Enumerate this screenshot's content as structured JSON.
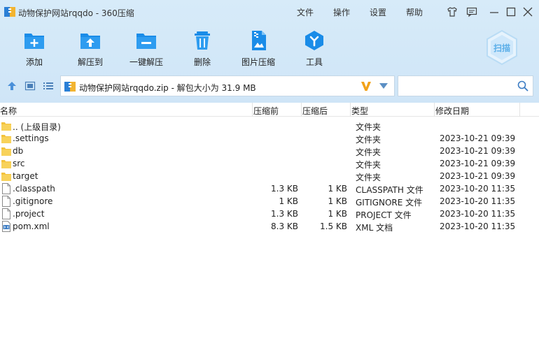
{
  "window": {
    "title": "动物保护网站rqqdo - 360压缩",
    "menu": [
      "文件",
      "操作",
      "设置",
      "帮助"
    ]
  },
  "toolbar": {
    "items": [
      {
        "label": "添加",
        "icon": "add-icon"
      },
      {
        "label": "解压到",
        "icon": "extract-to-icon"
      },
      {
        "label": "一键解压",
        "icon": "one-click-extract-icon"
      },
      {
        "label": "删除",
        "icon": "delete-icon"
      },
      {
        "label": "图片压缩",
        "icon": "image-compress-icon"
      },
      {
        "label": "工具",
        "icon": "tools-icon"
      }
    ],
    "scan_label": "扫描"
  },
  "address": {
    "path": "动物保护网站rqqdo.zip - 解包大小为 31.9 MB"
  },
  "search": {
    "placeholder": "",
    "value": ""
  },
  "list": {
    "columns": [
      "名称",
      "压缩前",
      "压缩后",
      "类型",
      "修改日期"
    ],
    "rows": [
      {
        "name": ".. (上级目录)",
        "size": "",
        "csize": "",
        "type": "文件夹",
        "date": "",
        "kind": "folder"
      },
      {
        "name": ".settings",
        "size": "",
        "csize": "",
        "type": "文件夹",
        "date": "2023-10-21 09:39",
        "kind": "folder"
      },
      {
        "name": "db",
        "size": "",
        "csize": "",
        "type": "文件夹",
        "date": "2023-10-21 09:39",
        "kind": "folder"
      },
      {
        "name": "src",
        "size": "",
        "csize": "",
        "type": "文件夹",
        "date": "2023-10-21 09:39",
        "kind": "folder"
      },
      {
        "name": "target",
        "size": "",
        "csize": "",
        "type": "文件夹",
        "date": "2023-10-21 09:39",
        "kind": "folder"
      },
      {
        "name": ".classpath",
        "size": "1.3 KB",
        "csize": "1 KB",
        "type": "CLASSPATH 文件",
        "date": "2023-10-20 11:35",
        "kind": "file"
      },
      {
        "name": ".gitignore",
        "size": "1 KB",
        "csize": "1 KB",
        "type": "GITIGNORE 文件",
        "date": "2023-10-20 11:35",
        "kind": "file"
      },
      {
        "name": ".project",
        "size": "1.3 KB",
        "csize": "1 KB",
        "type": "PROJECT 文件",
        "date": "2023-10-20 11:35",
        "kind": "file"
      },
      {
        "name": "pom.xml",
        "size": "8.3 KB",
        "csize": "1.5 KB",
        "type": "XML 文档",
        "date": "2023-10-20 11:35",
        "kind": "xml"
      }
    ]
  },
  "colors": {
    "toolbar_bg": "#d3e8f8",
    "accent": "#1a8ce8",
    "folder": "#f3c23c"
  }
}
